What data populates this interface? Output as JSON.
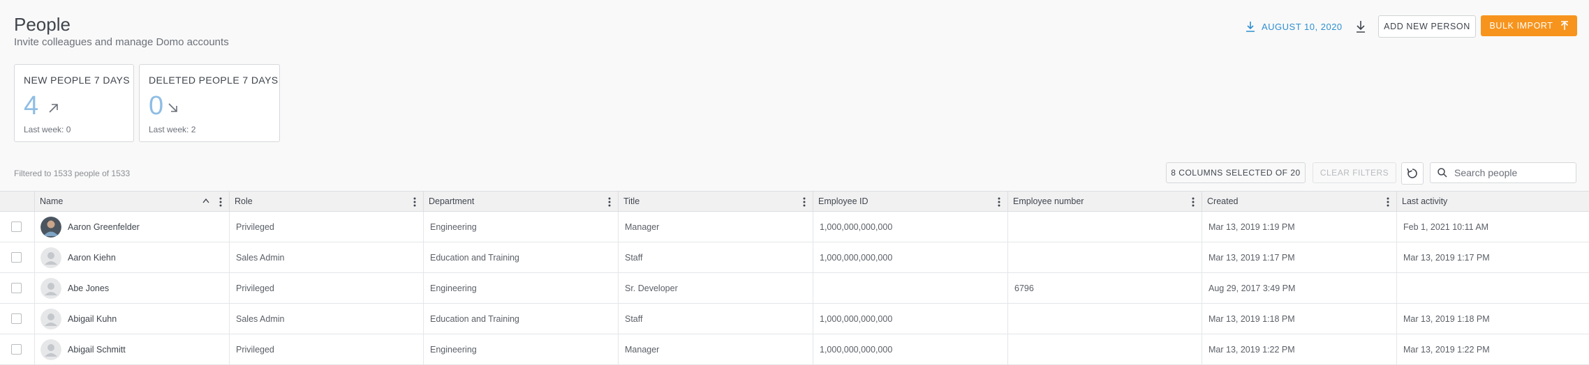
{
  "header": {
    "title": "People",
    "subtitle": "Invite colleagues and manage Domo accounts",
    "date_label": "AUGUST 10, 2020",
    "add_person_label": "ADD NEW PERSON",
    "bulk_import_label": "BULK IMPORT"
  },
  "stats": [
    {
      "label": "NEW PEOPLE 7 DAYS",
      "value": "4",
      "trend": "up",
      "sub": "Last week: 0"
    },
    {
      "label": "DELETED PEOPLE 7 DAYS",
      "value": "0",
      "trend": "down",
      "sub": "Last week: 2"
    }
  ],
  "toolbar": {
    "filter_text": "Filtered to 1533 people of 1533",
    "columns_label": "8 COLUMNS SELECTED OF 20",
    "clear_filters_label": "CLEAR FILTERS",
    "search_placeholder": "Search people"
  },
  "columns": [
    "Name",
    "Role",
    "Department",
    "Title",
    "Employee ID",
    "Employee number",
    "Created",
    "Last activity"
  ],
  "rows": [
    {
      "name": "Aaron Greenfelder",
      "role": "Privileged",
      "department": "Engineering",
      "title": "Manager",
      "employee_id": "1,000,000,000,000",
      "employee_number": "",
      "created": "Mar 13, 2019 1:19 PM",
      "last_activity": "Feb 1, 2021 10:11 AM",
      "avatar": "photo"
    },
    {
      "name": "Aaron Kiehn",
      "role": "Sales Admin",
      "department": "Education and Training",
      "title": "Staff",
      "employee_id": "1,000,000,000,000",
      "employee_number": "",
      "created": "Mar 13, 2019 1:17 PM",
      "last_activity": "Mar 13, 2019 1:17 PM",
      "avatar": "default"
    },
    {
      "name": "Abe Jones",
      "role": "Privileged",
      "department": "Engineering",
      "title": "Sr. Developer",
      "employee_id": "",
      "employee_number": "6796",
      "created": "Aug 29, 2017 3:49 PM",
      "last_activity": "",
      "avatar": "default"
    },
    {
      "name": "Abigail Kuhn",
      "role": "Sales Admin",
      "department": "Education and Training",
      "title": "Staff",
      "employee_id": "1,000,000,000,000",
      "employee_number": "",
      "created": "Mar 13, 2019 1:18 PM",
      "last_activity": "Mar 13, 2019 1:18 PM",
      "avatar": "default"
    },
    {
      "name": "Abigail Schmitt",
      "role": "Privileged",
      "department": "Engineering",
      "title": "Manager",
      "employee_id": "1,000,000,000,000",
      "employee_number": "",
      "created": "Mar 13, 2019 1:22 PM",
      "last_activity": "Mar 13, 2019 1:22 PM",
      "avatar": "default"
    }
  ],
  "colors": {
    "accent_blue": "#2e8fd1",
    "orange": "#f7941d",
    "stat_value": "#8fbde4"
  }
}
